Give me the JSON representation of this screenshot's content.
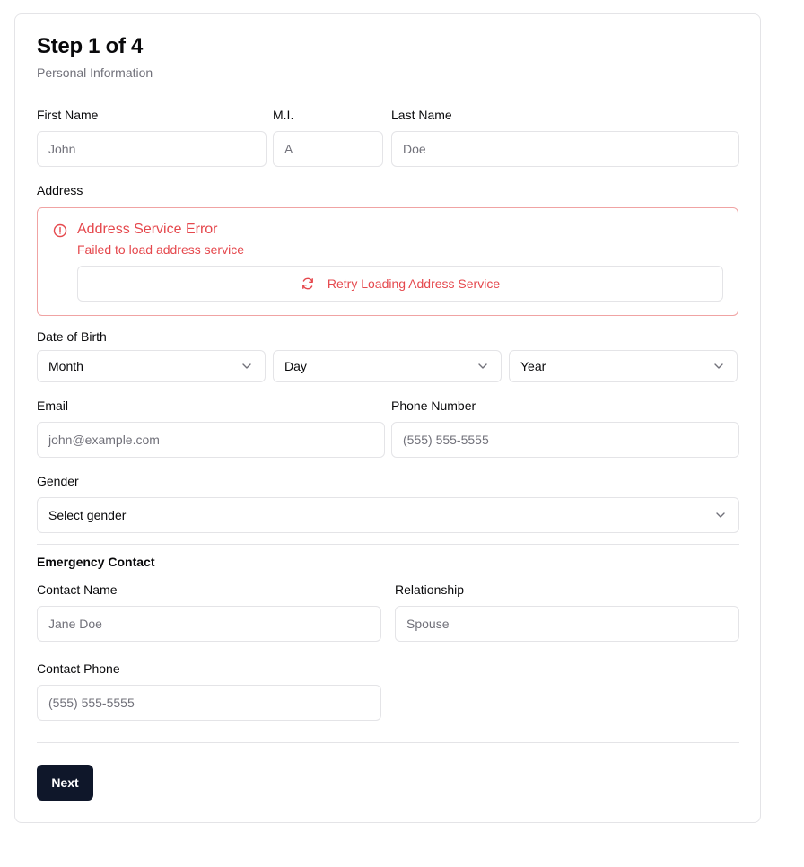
{
  "header": {
    "title": "Step 1 of 4",
    "subtitle": "Personal Information"
  },
  "name": {
    "first_label": "First Name",
    "first_placeholder": "John",
    "mi_label": "M.I.",
    "mi_placeholder": "A",
    "last_label": "Last Name",
    "last_placeholder": "Doe"
  },
  "address": {
    "label": "Address",
    "error_title": "Address Service Error",
    "error_message": "Failed to load address service",
    "retry_label": "Retry Loading Address Service",
    "icons": {
      "alert": "alert-circle-icon",
      "retry": "refresh-icon"
    },
    "error_color": "#e5484d"
  },
  "dob": {
    "label": "Date of Birth",
    "month": "Month",
    "day": "Day",
    "year": "Year"
  },
  "contact": {
    "email_label": "Email",
    "email_placeholder": "john@example.com",
    "phone_label": "Phone Number",
    "phone_placeholder": "(555) 555-5555"
  },
  "gender": {
    "label": "Gender",
    "value": "Select gender"
  },
  "emergency": {
    "section_title": "Emergency Contact",
    "name_label": "Contact Name",
    "name_placeholder": "Jane Doe",
    "relationship_label": "Relationship",
    "relationship_placeholder": "Spouse",
    "phone_label": "Contact Phone",
    "phone_placeholder": "(555) 555-5555"
  },
  "footer": {
    "next_label": "Next"
  },
  "colors": {
    "primary_button": "#0f172a",
    "border": "#e4e4e7",
    "error": "#e5484d"
  }
}
